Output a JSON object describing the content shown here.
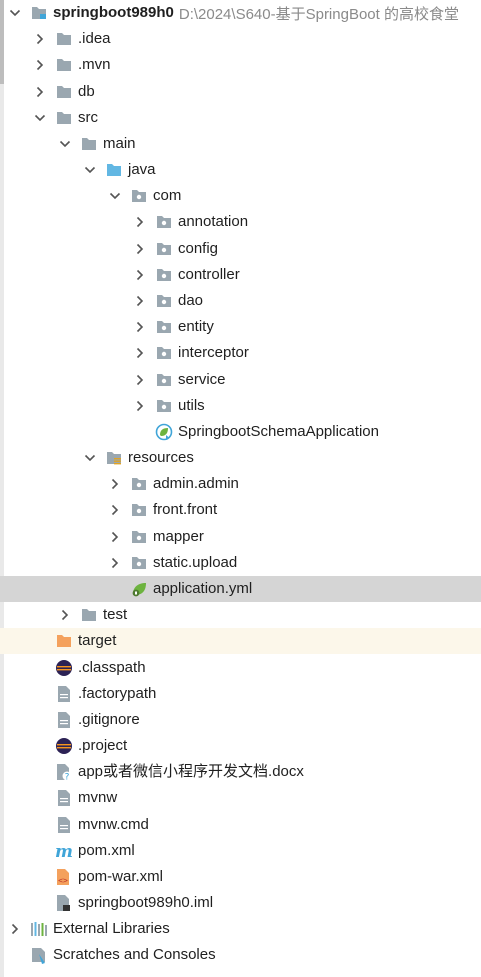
{
  "project": {
    "name": "springboot989h0",
    "path": "D:\\2024\\S640-基于SpringBoot 的高校食堂"
  },
  "items": [
    {
      "label": "springboot989h0",
      "depth": 0,
      "arrow": "down",
      "icon": "module-folder-icon",
      "bold": true,
      "path": true
    },
    {
      "label": ".idea",
      "depth": 1,
      "arrow": "right",
      "icon": "folder-icon"
    },
    {
      "label": ".mvn",
      "depth": 1,
      "arrow": "right",
      "icon": "folder-icon"
    },
    {
      "label": "db",
      "depth": 1,
      "arrow": "right",
      "icon": "folder-icon"
    },
    {
      "label": "src",
      "depth": 1,
      "arrow": "down",
      "icon": "folder-icon"
    },
    {
      "label": "main",
      "depth": 2,
      "arrow": "down",
      "icon": "folder-icon"
    },
    {
      "label": "java",
      "depth": 3,
      "arrow": "down",
      "icon": "source-folder-icon"
    },
    {
      "label": "com",
      "depth": 4,
      "arrow": "down",
      "icon": "package-icon"
    },
    {
      "label": "annotation",
      "depth": 5,
      "arrow": "right",
      "icon": "package-icon"
    },
    {
      "label": "config",
      "depth": 5,
      "arrow": "right",
      "icon": "package-icon"
    },
    {
      "label": "controller",
      "depth": 5,
      "arrow": "right",
      "icon": "package-icon"
    },
    {
      "label": "dao",
      "depth": 5,
      "arrow": "right",
      "icon": "package-icon"
    },
    {
      "label": "entity",
      "depth": 5,
      "arrow": "right",
      "icon": "package-icon"
    },
    {
      "label": "interceptor",
      "depth": 5,
      "arrow": "right",
      "icon": "package-icon"
    },
    {
      "label": "service",
      "depth": 5,
      "arrow": "right",
      "icon": "package-icon"
    },
    {
      "label": "utils",
      "depth": 5,
      "arrow": "right",
      "icon": "package-icon"
    },
    {
      "label": "SpringbootSchemaApplication",
      "depth": 5,
      "arrow": "none",
      "icon": "spring-boot-app-icon"
    },
    {
      "label": "resources",
      "depth": 3,
      "arrow": "down",
      "icon": "resources-folder-icon"
    },
    {
      "label": "admin.admin",
      "depth": 4,
      "arrow": "right",
      "icon": "package-icon"
    },
    {
      "label": "front.front",
      "depth": 4,
      "arrow": "right",
      "icon": "package-icon"
    },
    {
      "label": "mapper",
      "depth": 4,
      "arrow": "right",
      "icon": "package-icon"
    },
    {
      "label": "static.upload",
      "depth": 4,
      "arrow": "right",
      "icon": "package-icon"
    },
    {
      "label": "application.yml",
      "depth": 4,
      "arrow": "none",
      "icon": "spring-yml-icon",
      "selected": true
    },
    {
      "label": "test",
      "depth": 2,
      "arrow": "right",
      "icon": "folder-icon"
    },
    {
      "label": "target",
      "depth": 1,
      "arrow": "none",
      "icon": "excluded-folder-icon",
      "excluded": true
    },
    {
      "label": ".classpath",
      "depth": 1,
      "arrow": "none",
      "icon": "eclipse-icon"
    },
    {
      "label": ".factorypath",
      "depth": 1,
      "arrow": "none",
      "icon": "file-icon"
    },
    {
      "label": ".gitignore",
      "depth": 1,
      "arrow": "none",
      "icon": "file-icon"
    },
    {
      "label": ".project",
      "depth": 1,
      "arrow": "none",
      "icon": "eclipse-icon"
    },
    {
      "label": "app或者微信小程序开发文档.docx",
      "depth": 1,
      "arrow": "none",
      "icon": "unknown-file-icon"
    },
    {
      "label": "mvnw",
      "depth": 1,
      "arrow": "none",
      "icon": "file-icon"
    },
    {
      "label": "mvnw.cmd",
      "depth": 1,
      "arrow": "none",
      "icon": "file-icon"
    },
    {
      "label": "pom.xml",
      "depth": 1,
      "arrow": "none",
      "icon": "maven-icon"
    },
    {
      "label": "pom-war.xml",
      "depth": 1,
      "arrow": "none",
      "icon": "xml-file-icon"
    },
    {
      "label": "springboot989h0.iml",
      "depth": 1,
      "arrow": "none",
      "icon": "iml-file-icon"
    },
    {
      "label": "External Libraries",
      "depth": 0,
      "arrow": "right",
      "icon": "libraries-icon"
    },
    {
      "label": "Scratches and Consoles",
      "depth": 0,
      "arrow": "none",
      "icon": "scratches-icon"
    }
  ],
  "colors": {
    "folder": "#9aa7b0",
    "source_folder": "#62b7e3",
    "excluded_folder": "#f4a15d",
    "spring_green": "#6db33f",
    "selected_row": "#d5d5d5",
    "excluded_row": "#fcf7ea",
    "path_text": "#8a8a8a"
  }
}
